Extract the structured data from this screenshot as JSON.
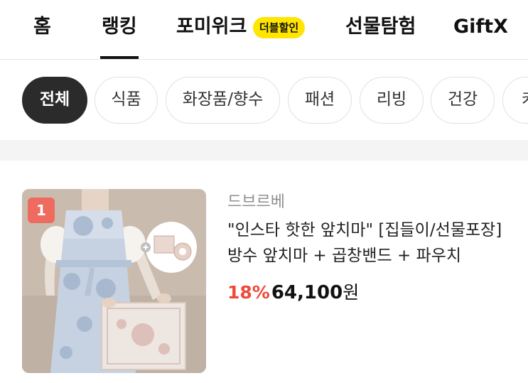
{
  "nav": {
    "tabs": [
      {
        "label": "홈"
      },
      {
        "label": "랭킹",
        "active": true
      },
      {
        "label": "포미위크",
        "badge": "더블할인"
      },
      {
        "label": "선물탐험"
      },
      {
        "label": "GiftX"
      }
    ]
  },
  "categories": [
    "전체",
    "식품",
    "화장품/향수",
    "패션",
    "리빙",
    "건강",
    "카"
  ],
  "product": {
    "rank": "1",
    "brand": "드브르베",
    "title": "\"인스타 핫한 앞치마\" [집들이/선물포장] 방수 앞치마 + 곱창밴드 + 파우치",
    "discount": "18%",
    "price": "64,100",
    "currency": "원"
  },
  "colors": {
    "accent_yellow": "#ffe500",
    "discount_red": "#ee4a3a",
    "rank_badge": "#ee6b5f",
    "active_chip": "#2b2b2b"
  }
}
